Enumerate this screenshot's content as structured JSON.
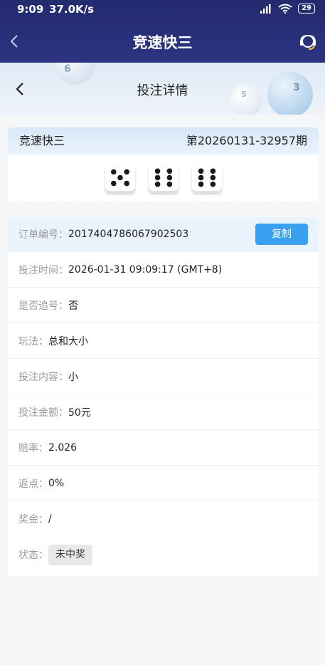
{
  "status_bar": {
    "time": "9:09",
    "speed": "37.0K/s",
    "battery": "29"
  },
  "app_header": {
    "title": "竞速快三"
  },
  "sub_header": {
    "title": "投注详情",
    "balls": [
      "3",
      "5",
      "6"
    ]
  },
  "lottery": {
    "name": "竞速快三",
    "issue": "第20260131-32957期",
    "dice": [
      5,
      6,
      6
    ]
  },
  "details": {
    "order_no_label": "订单编号：",
    "order_no": "2017404786067902503",
    "copy_label": "复制",
    "rows": [
      {
        "label": "投注时间：",
        "value": "2026-01-31 09:09:17 (GMT+8)"
      },
      {
        "label": "是否追号：",
        "value": "否"
      },
      {
        "label": "玩法：",
        "value": "总和大小"
      },
      {
        "label": "投注内容：",
        "value": "小"
      },
      {
        "label": "投注金额：",
        "value": "50元"
      },
      {
        "label": "赔率：",
        "value": "2.026"
      },
      {
        "label": "返点：",
        "value": "0%"
      },
      {
        "label": "奖金：",
        "value": "/"
      }
    ],
    "status_label": "状态：",
    "status_value": "未中奖"
  },
  "colors": {
    "header": "#2c3483",
    "accent": "#3aa0f0"
  }
}
